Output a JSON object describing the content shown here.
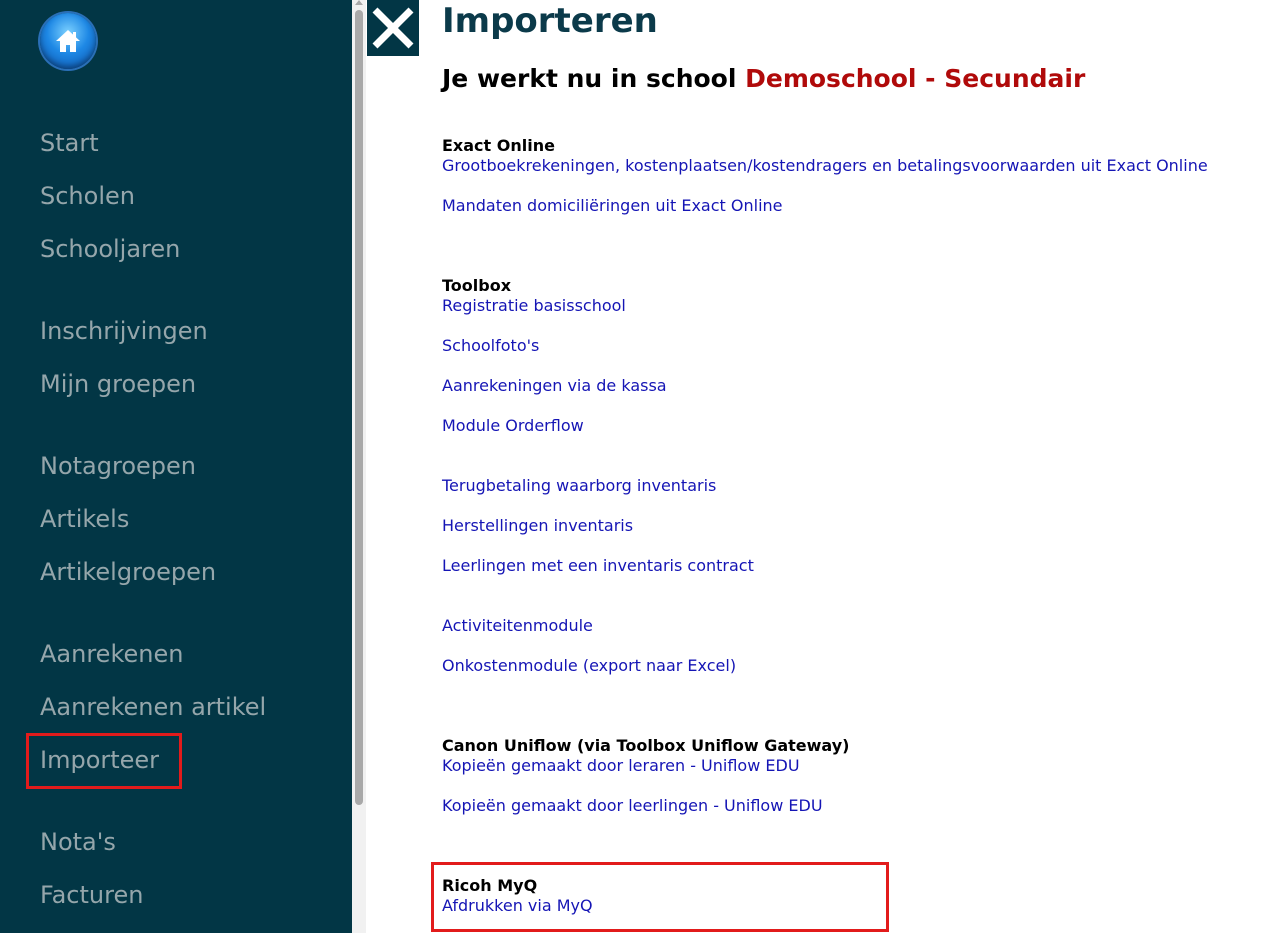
{
  "sidebar": {
    "home_icon": "home-icon",
    "items": [
      {
        "label": "Start"
      },
      {
        "label": "Scholen"
      },
      {
        "label": "Schooljaren"
      },
      {
        "label": "Inschrijvingen"
      },
      {
        "label": "Mijn groepen"
      },
      {
        "label": "Notagroepen"
      },
      {
        "label": "Artikels"
      },
      {
        "label": "Artikelgroepen"
      },
      {
        "label": "Aanrekenen"
      },
      {
        "label": "Aanrekenen artikel"
      },
      {
        "label": "Importeer",
        "highlighted": true
      },
      {
        "label": "Nota's"
      },
      {
        "label": "Facturen"
      }
    ]
  },
  "header": {
    "close_icon": "close-icon",
    "title": "Importeren",
    "school_prefix": "Je werkt nu in school ",
    "school_name": "Demoschool - Secundair"
  },
  "sections": [
    {
      "heading": "Exact Online",
      "links": [
        "Grootboekrekeningen, kostenplaatsen/kostendragers en betalingsvoorwaarden uit Exact Online",
        "Mandaten domiciliëringen uit Exact Online"
      ]
    },
    {
      "heading": "Toolbox",
      "links": [
        "Registratie basisschool",
        "Schoolfoto's",
        "Aanrekeningen via de kassa",
        "Module Orderflow",
        "Terugbetaling waarborg inventaris",
        "Herstellingen inventaris",
        "Leerlingen met een inventaris contract",
        "Activiteitenmodule",
        "Onkostenmodule (export naar Excel)"
      ]
    },
    {
      "heading": "Canon Uniflow (via Toolbox Uniflow Gateway)",
      "links": [
        "Kopieën gemaakt door leraren - Uniflow EDU",
        "Kopieën gemaakt door leerlingen - Uniflow EDU"
      ]
    },
    {
      "heading": "Ricoh MyQ",
      "highlighted": true,
      "links": [
        "Afdrukken via MyQ"
      ]
    }
  ],
  "colors": {
    "sidebar_bg": "#023645",
    "nav_text": "#95a6ab",
    "title": "#0b3a4a",
    "school_name": "#b00a0a",
    "link": "#1515b5",
    "highlight": "#e21b1b"
  }
}
